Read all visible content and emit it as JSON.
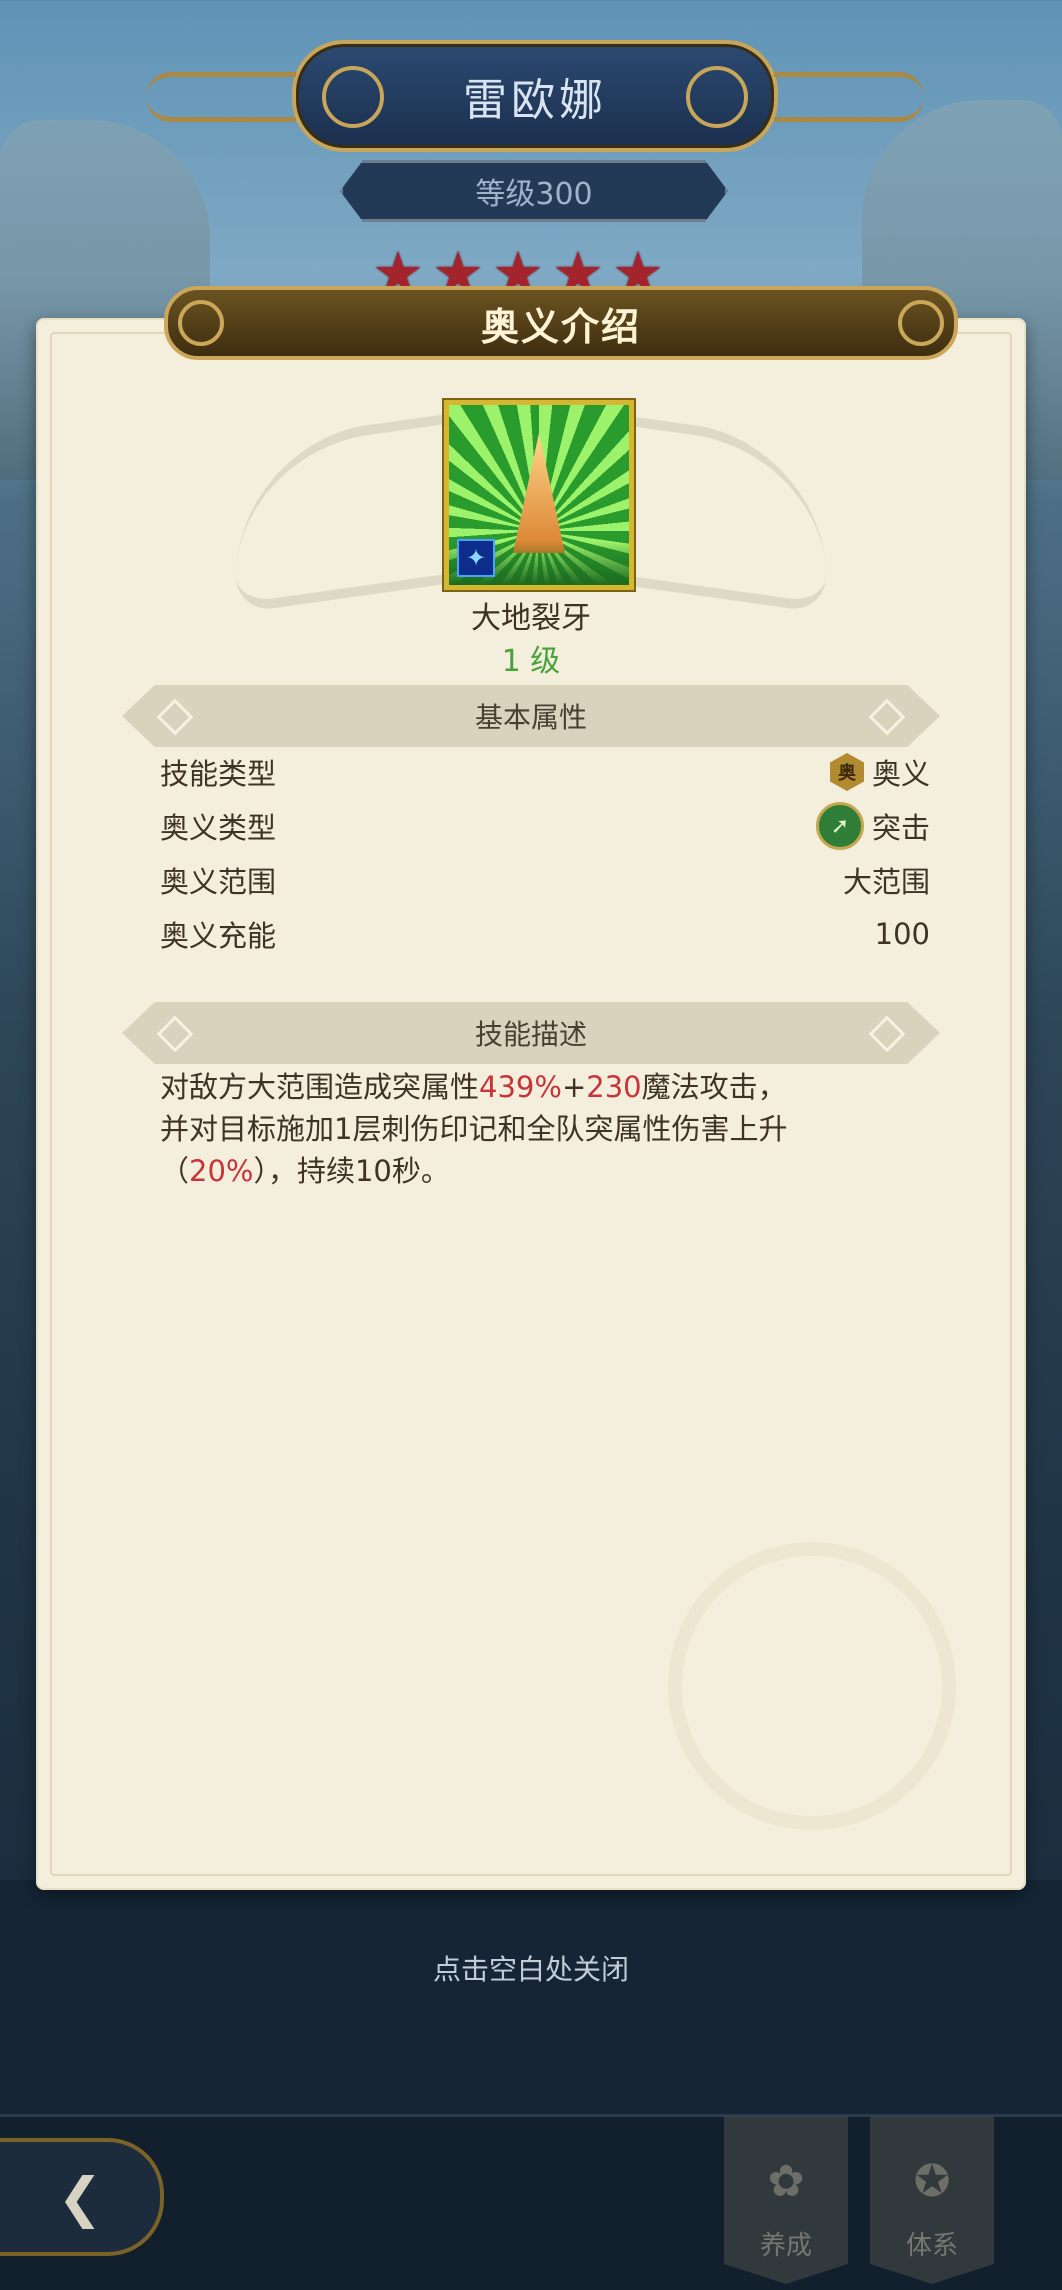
{
  "hero": {
    "name": "雷欧娜",
    "level_label": "等级300",
    "stars": 5,
    "star_glyph": "★"
  },
  "panel": {
    "title": "奥义介绍",
    "skill": {
      "name": "大地裂牙",
      "level": "1 级",
      "badge_glyph": "✦"
    },
    "basic_section_title": "基本属性",
    "attributes": [
      {
        "label": "技能类型",
        "value": "奥义",
        "icon": "ao-hex-icon",
        "icon_glyph": "奥"
      },
      {
        "label": "奥义类型",
        "value": "突击",
        "icon": "arrow-assault-icon",
        "icon_glyph": "➚"
      },
      {
        "label": "奥义范围",
        "value": "大范围"
      },
      {
        "label": "奥义充能",
        "value": "100"
      }
    ],
    "desc_section_title": "技能描述",
    "description": {
      "p1": "对敌方大范围造成突属性",
      "v1": "439%",
      "p2": "+",
      "v2": "230",
      "p3": "魔法攻击，",
      "line2": "并对目标施加1层刺伤印记和全队突属性伤害上升",
      "p4": "（",
      "v3": "20%",
      "p5": "），持续10秒。"
    }
  },
  "close_hint": "点击空白处关闭",
  "bottom_nav": {
    "back_glyph": "❮",
    "tabs": [
      {
        "label": "养成",
        "icon": "cultivate-icon",
        "glyph": "✿"
      },
      {
        "label": "体系",
        "icon": "system-icon",
        "glyph": "✪"
      }
    ]
  },
  "colors": {
    "highlight": "#c8343a",
    "level_green": "#47a23a",
    "gold": "#caa759",
    "star_red": "#a4242d"
  }
}
